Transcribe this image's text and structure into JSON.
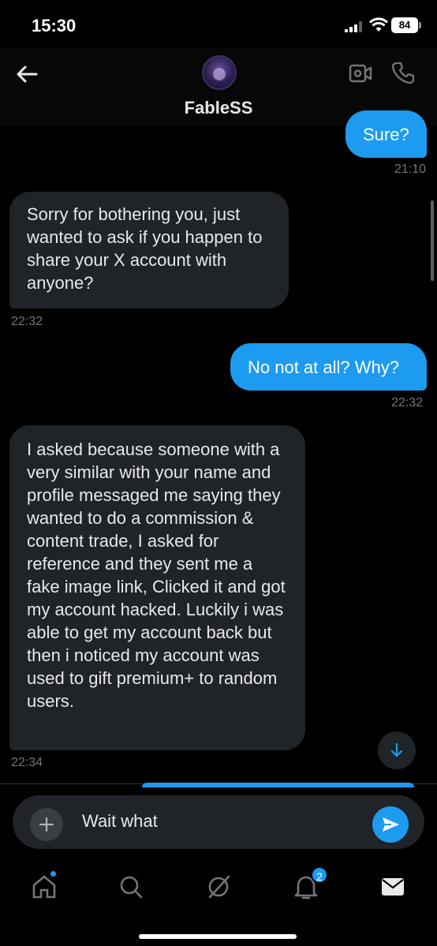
{
  "status_bar": {
    "time": "15:30",
    "battery": "84"
  },
  "header": {
    "contact_name": "FableSS",
    "icons": [
      "back-arrow-icon",
      "avatar",
      "video-call-icon",
      "phone-icon"
    ]
  },
  "messages": [
    {
      "direction": "sent",
      "text": "Sure?",
      "time": "21:10"
    },
    {
      "direction": "received",
      "text": "Sorry for bothering you, just wanted to ask if you happen to share your X account with anyone?",
      "time": "22:32"
    },
    {
      "direction": "sent",
      "text": "No not at all? Why?",
      "time": "22:32"
    },
    {
      "direction": "received",
      "text": "I asked because someone with a very similar with your name and profile messaged me saying they wanted to do a commission & content trade, I asked for reference and they sent me a fake image link, Clicked it and got my account hacked. Luckily i was able to get my account back but then i noticed my account was used to gift premium+ to random users.",
      "time": "22:34"
    }
  ],
  "composer": {
    "value": "Wait what"
  },
  "tab_bar": {
    "items": [
      "home-icon",
      "search-icon",
      "grok-icon",
      "notifications-icon",
      "messages-icon"
    ],
    "notification_count": "2"
  },
  "colors": {
    "accent": "#1d9bf0",
    "received_bubble": "#202327",
    "background": "#000000"
  }
}
